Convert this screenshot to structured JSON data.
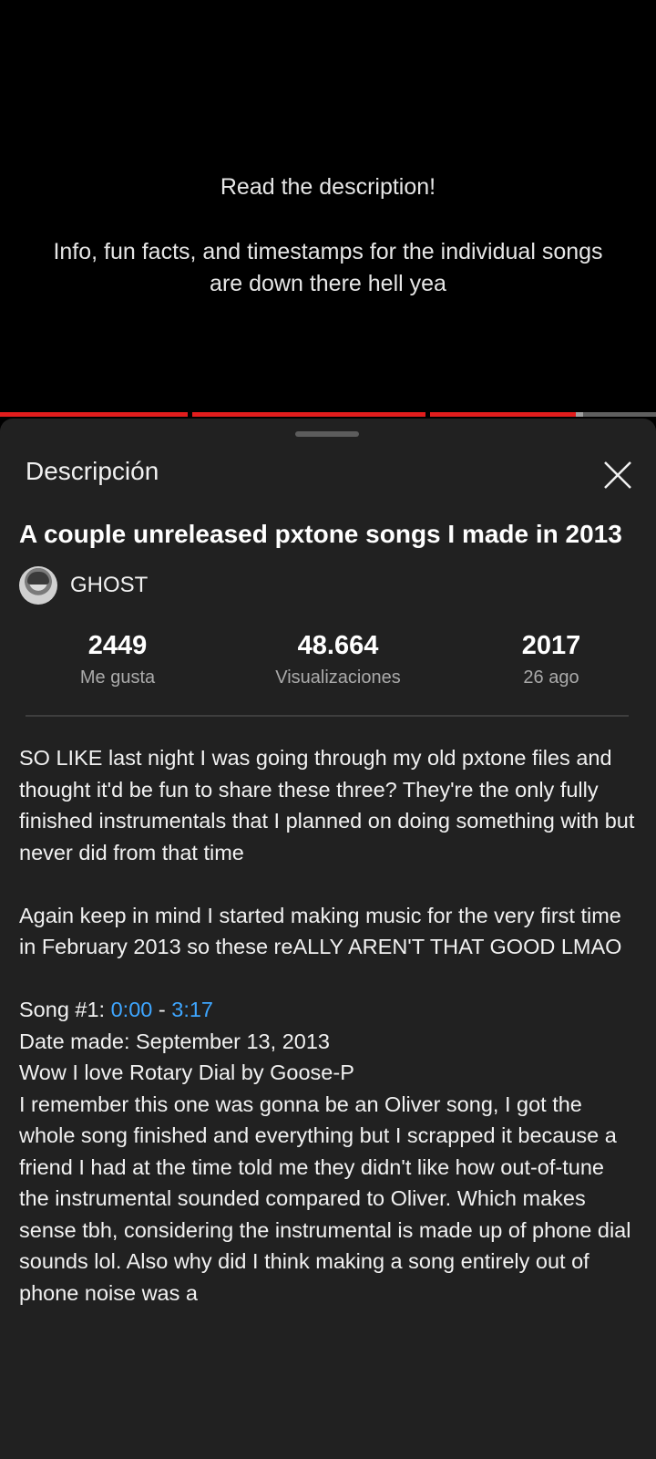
{
  "video": {
    "overlay_line1": "Read the description!",
    "overlay_line2": "Info, fun facts, and timestamps for the individual songs",
    "overlay_line3": "are down there hell yea",
    "progress_fraction": 0.88,
    "progress_color": "#e21d1d"
  },
  "sheet": {
    "title": "Descripción",
    "close_icon": "close-icon"
  },
  "details": {
    "title": "A couple unreleased pxtone songs I made in 2013",
    "channel_name": "GHOST",
    "stats": [
      {
        "value": "2449",
        "label": "Me gusta"
      },
      {
        "value": "48.664",
        "label": "Visualizaciones"
      },
      {
        "value": "2017",
        "label": "26 ago"
      }
    ]
  },
  "description": {
    "para1": "SO LIKE last night I was going through my old pxtone files and thought it'd be fun to share these three? They're the only fully finished instrumentals that I planned on doing something with but never did from that time",
    "para2": "Again keep in mind I started making music for the very first time in February 2013 so these reALLY AREN'T THAT GOOD LMAO",
    "song1_prefix": "Song #1: ",
    "song1_start": "0:00",
    "song1_dash": " - ",
    "song1_end": "3:17",
    "date_line": "Date made: September 13, 2013",
    "line_rotary": "Wow I love Rotary Dial by Goose-P",
    "para3": "I remember this one was gonna be an Oliver song, I got the whole song finished and everything but I scrapped it because a friend I had at the time told me they didn't like how out-of-tune the instrumental sounded compared to Oliver. Which makes sense tbh, considering the instrumental is made up of phone dial sounds lol. Also why did I think making a song entirely out of phone noise was a"
  },
  "colors": {
    "link": "#3ea6ff",
    "sheet_bg": "#212121"
  }
}
